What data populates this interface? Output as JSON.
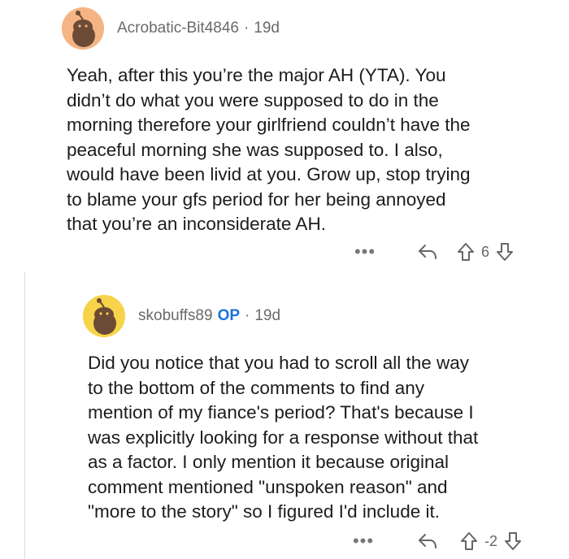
{
  "comments": [
    {
      "username": "Acrobatic-Bit4846",
      "separator": "·",
      "age": "19d",
      "body": "Yeah, after this you’re the major AH (YTA). You\ndidn’t do what you were supposed to do in the\nmorning therefore your girlfriend couldn’t have the\npeaceful morning she was supposed to. I also,\nwould have been livid at you. Grow up, stop trying\nto blame your gfs period for her being annoyed\nthat you’re an inconsiderate AH.",
      "more_label": "•••",
      "votes": "6",
      "avatar_bg": "#f5b483"
    },
    {
      "username": "skobuffs89",
      "op_badge": "OP",
      "separator": "·",
      "age": "19d",
      "body": "Did you notice that you had to scroll all the way\nto the bottom of the comments to find any\nmention of my fiance's period? That's because I\nwas explicitly looking for a response without that\nas a factor. I only mention it because original\ncomment mentioned \"unspoken reason\" and\n\"more to the story\" so I figured I'd include it.",
      "more_label": "•••",
      "votes": "-2",
      "avatar_bg": "#f7d34a"
    }
  ],
  "icons": [
    "more-icon",
    "reply-icon",
    "upvote-icon",
    "downvote-icon"
  ]
}
